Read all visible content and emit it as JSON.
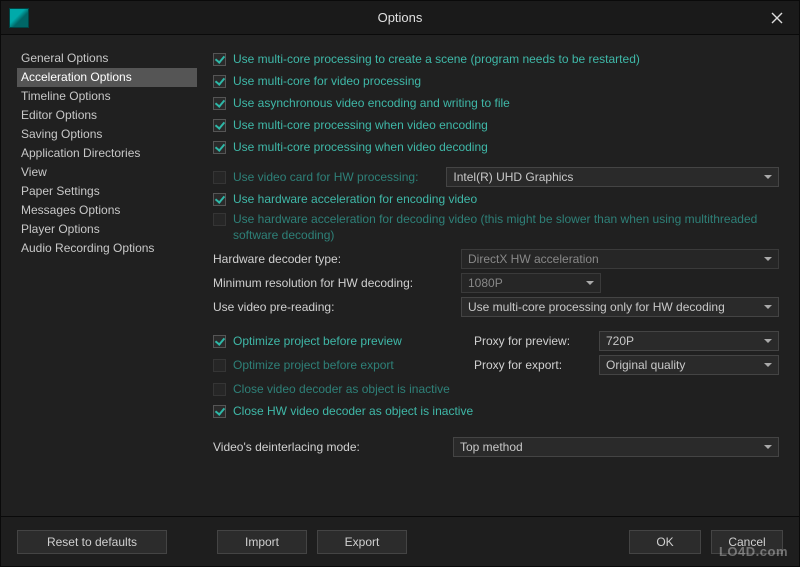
{
  "window": {
    "title": "Options"
  },
  "sidebar": {
    "items": [
      "General Options",
      "Acceleration Options",
      "Timeline Options",
      "Editor Options",
      "Saving Options",
      "Application Directories",
      "View",
      "Paper Settings",
      "Messages Options",
      "Player Options",
      "Audio Recording Options"
    ],
    "selected_index": 1
  },
  "options": {
    "multicore_scene": "Use multi-core processing to create a scene (program needs to be restarted)",
    "multicore_video": "Use multi-core for video processing",
    "async_encoding": "Use asynchronous video encoding and writing to file",
    "multicore_encoding": "Use multi-core processing when video encoding",
    "multicore_decoding": "Use multi-core processing when video decoding",
    "hw_processing_label": "Use video card for HW processing:",
    "hw_processing_value": "Intel(R) UHD Graphics",
    "hw_encode": "Use hardware acceleration for encoding video",
    "hw_decode": "Use hardware acceleration for decoding video (this might be slower than when using multithreaded software decoding)",
    "hw_decoder_type_label": "Hardware decoder type:",
    "hw_decoder_type_value": "DirectX HW acceleration",
    "min_res_label": "Minimum resolution for HW decoding:",
    "min_res_value": "1080P",
    "pre_reading_label": "Use video pre-reading:",
    "pre_reading_value": "Use multi-core processing only for HW decoding",
    "optimize_preview": "Optimize project before preview",
    "optimize_export": "Optimize project before export",
    "close_decoder": "Close video decoder as object is inactive",
    "close_hw_decoder": "Close HW video decoder as object is inactive",
    "proxy_preview_label": "Proxy for preview:",
    "proxy_preview_value": "720P",
    "proxy_export_label": "Proxy for export:",
    "proxy_export_value": "Original quality",
    "deinterlace_label": "Video's deinterlacing mode:",
    "deinterlace_value": "Top method"
  },
  "footer": {
    "reset": "Reset to defaults",
    "import": "Import",
    "export": "Export",
    "ok": "OK",
    "cancel": "Cancel"
  },
  "watermark": "LO4D.com"
}
